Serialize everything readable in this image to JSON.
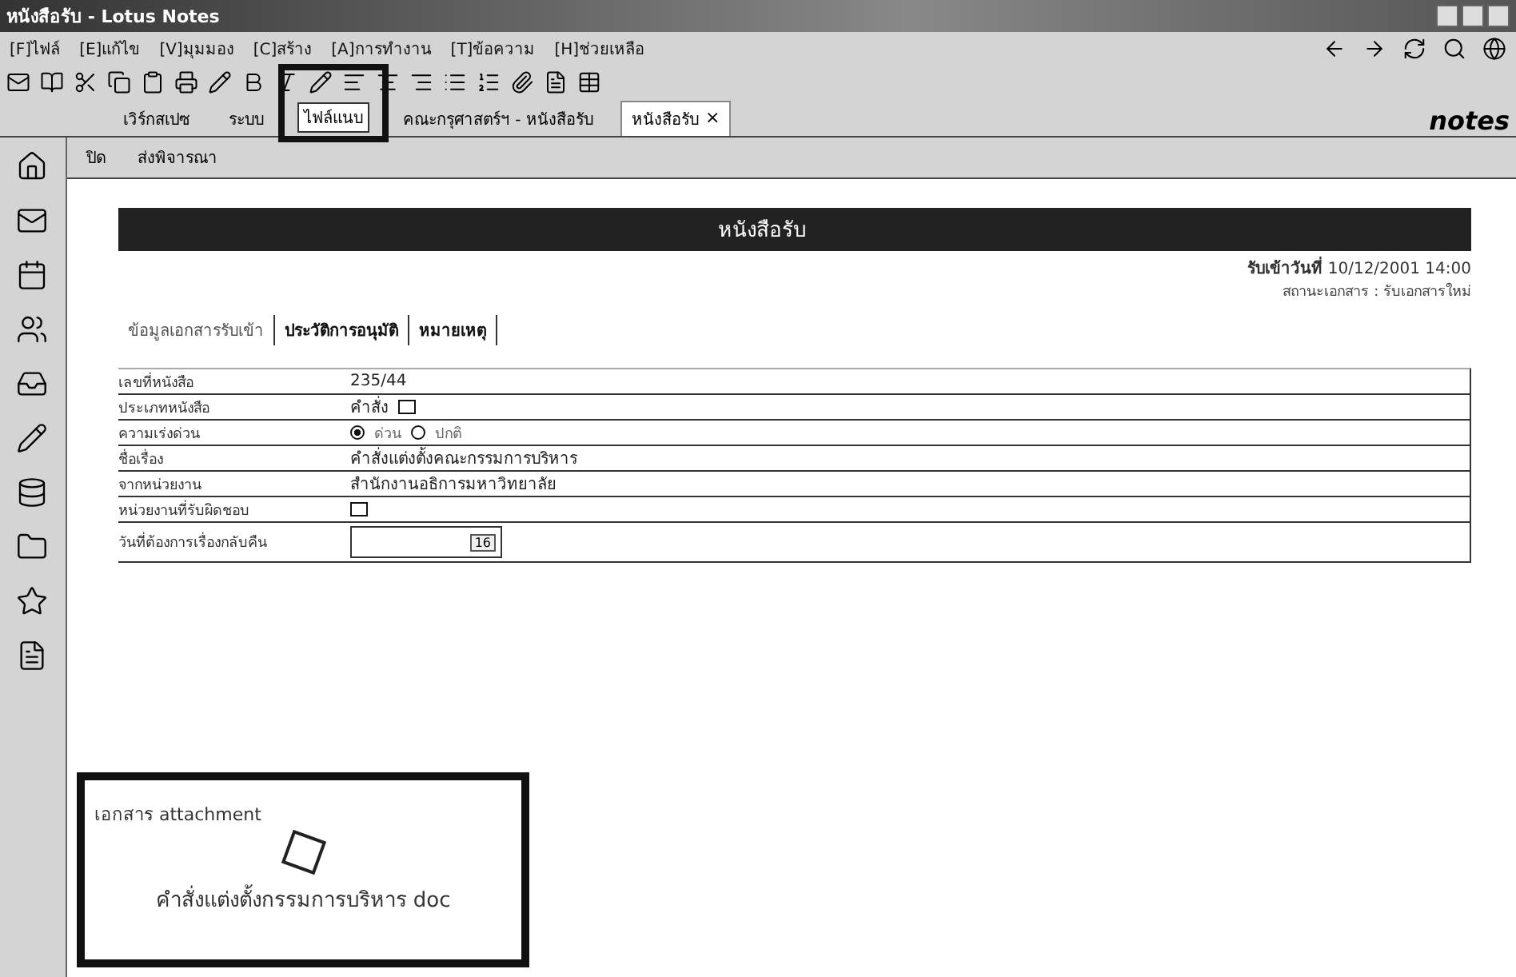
{
  "window": {
    "title": "หนังสือรับ - Lotus Notes"
  },
  "menu": [
    "[F]ไฟล์",
    "[E]แก้ไข",
    "[V]มุมมอง",
    "[C]สร้าง",
    "[A]การทำงาน",
    "[T]ข้อความ",
    "[H]ช่วยเหลือ"
  ],
  "doc_tabs": [
    {
      "label": "เวิร์กสเปซ",
      "selected": false
    },
    {
      "label": "ระบบ",
      "selected": false
    },
    {
      "label": "คณะกรุศาสตร์ฯ - หนังสือรับ",
      "selected": false
    },
    {
      "label": "หนังสือรับ",
      "selected": true,
      "close": "×"
    }
  ],
  "tooltip": "ไฟล์แนบ",
  "brand": "notes",
  "actions": [
    "ปิด",
    "ส่งพิจารณา"
  ],
  "form": {
    "title": "หนังสือรับ",
    "received": {
      "label": "รับเข้าวันที่",
      "value": "10/12/2001 14:00"
    },
    "status": "สถานะเอกสาร : รับเอกสารใหม่",
    "tabs": [
      {
        "label": "ข้อมูลเอกสารรับเข้า",
        "selected": true
      },
      {
        "label": "ประวัติการอนุมัติ",
        "selected": false
      },
      {
        "label": "หมายเหตุ",
        "selected": false
      }
    ],
    "fields": [
      {
        "kind": "text",
        "label": "เลขที่หนังสือ",
        "value": "235/44"
      },
      {
        "kind": "select",
        "label": "ประเภทหนังสือ",
        "value": "คำสั่ง"
      },
      {
        "kind": "radio",
        "label": "ความเร่งด่วน",
        "options": [
          {
            "label": "ด่วน",
            "selected": true
          },
          {
            "label": "ปกติ",
            "selected": false
          }
        ]
      },
      {
        "kind": "text",
        "label": "ชื่อเรื่อง",
        "value": "คำสั่งแต่งตั้งคณะกรรมการบริหาร"
      },
      {
        "kind": "text",
        "label": "จากหน่วยงาน",
        "value": "สำนักงานอธิการมหาวิทยาลัย"
      },
      {
        "kind": "select",
        "label": "หน่วยงานที่รับผิดชอบ"
      },
      {
        "kind": "date",
        "label": "วันที่ต้องการเรื่องกลับคืน",
        "button": "16"
      }
    ]
  },
  "attachment": {
    "label": "เอกสาร attachment",
    "file": "คำสั่งแต่งตั้งกรรมการบริหาร doc"
  }
}
